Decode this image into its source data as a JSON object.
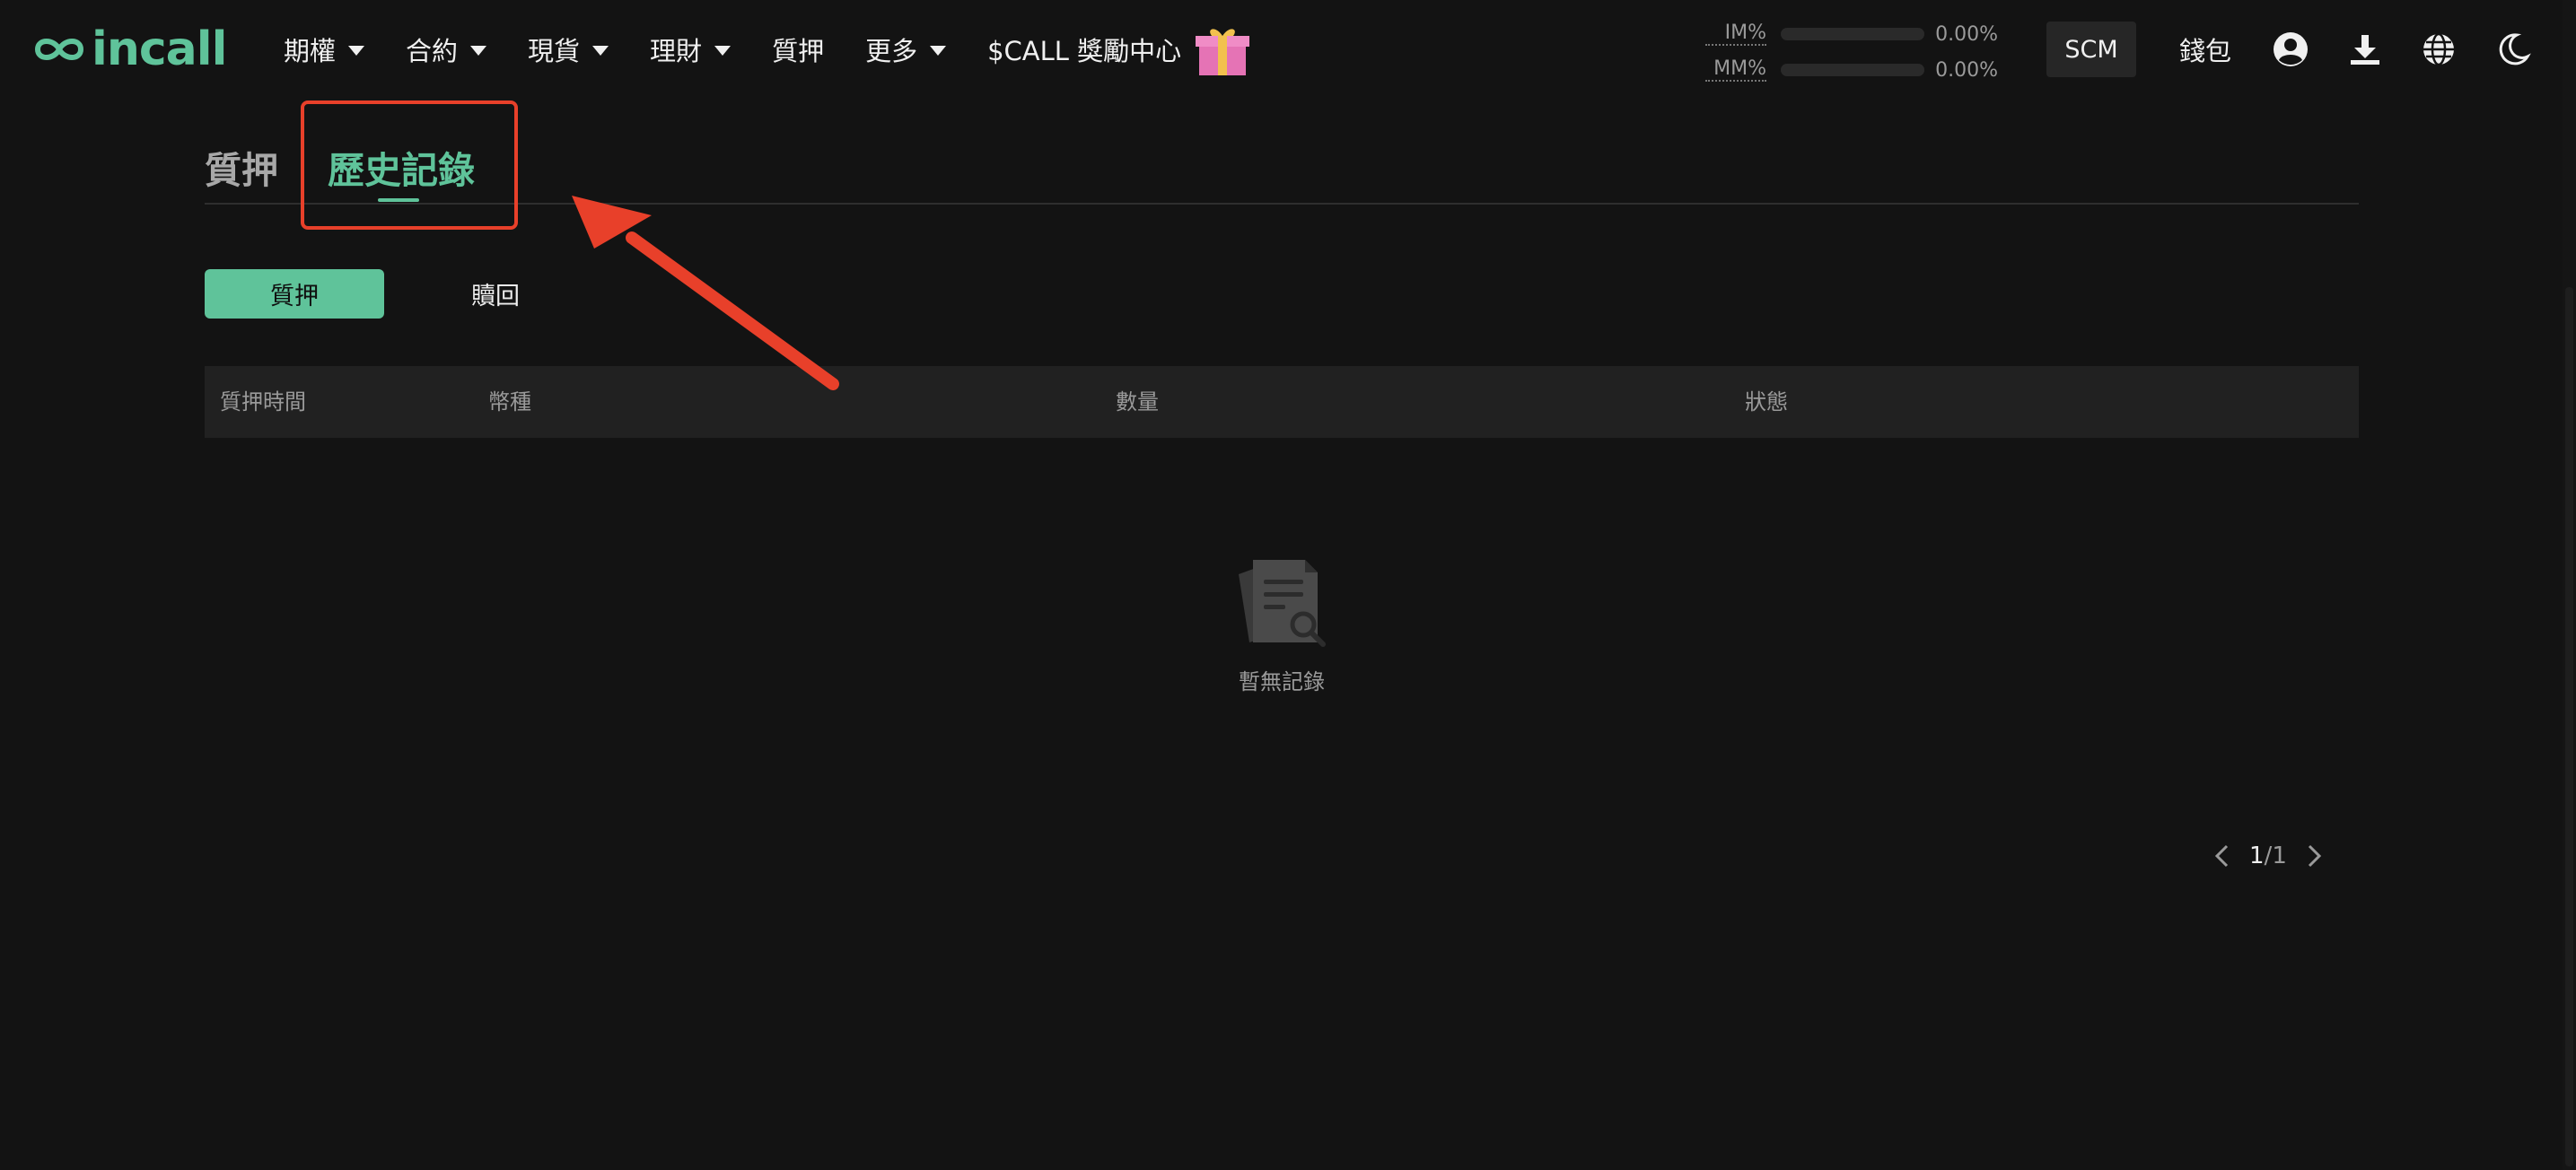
{
  "header": {
    "logo_text": "incall",
    "nav": [
      {
        "label": "期權",
        "dropdown": true
      },
      {
        "label": "合約",
        "dropdown": true
      },
      {
        "label": "現貨",
        "dropdown": true
      },
      {
        "label": "理財",
        "dropdown": true
      },
      {
        "label": "質押",
        "dropdown": false
      },
      {
        "label": "更多",
        "dropdown": true
      },
      {
        "label": "$CALL 獎勵中心",
        "dropdown": false
      }
    ],
    "im_label": "IM%",
    "im_value": "0.00%",
    "mm_label": "MM%",
    "mm_value": "0.00%",
    "scm_label": "SCM",
    "wallet_label": "錢包",
    "icons": [
      "account-icon",
      "download-icon",
      "globe-icon",
      "moon-icon",
      "gift-icon"
    ]
  },
  "tabs": {
    "staking": "質押",
    "history": "歷史記錄"
  },
  "segment": {
    "stake": "質押",
    "redeem": "贖回"
  },
  "table": {
    "columns": [
      "質押時間",
      "幣種",
      "數量",
      "狀態"
    ],
    "rows": []
  },
  "empty_state": {
    "text": "暫無記錄"
  },
  "pagination": {
    "current": "1",
    "separator": "/",
    "total": "1"
  },
  "colors": {
    "accent": "#5fc39a",
    "background": "#131313",
    "annotation": "#e8402a"
  }
}
